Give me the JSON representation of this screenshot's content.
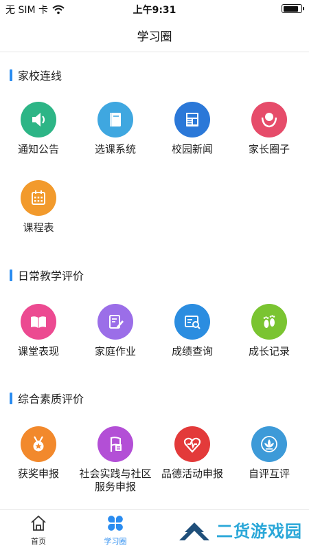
{
  "status_bar": {
    "carrier": "无 SIM 卡",
    "time": "上午9:31",
    "battery_level": 0.9
  },
  "nav": {
    "title": "学习圈"
  },
  "sections": [
    {
      "title": "家校连线",
      "items": [
        {
          "label": "通知公告",
          "icon": "speaker-icon",
          "color": "#2db586"
        },
        {
          "label": "选课系统",
          "icon": "book-icon",
          "color": "#3fa7e0"
        },
        {
          "label": "校园新闻",
          "icon": "newspaper-icon",
          "color": "#2b78d8"
        },
        {
          "label": "家长圈子",
          "icon": "parent-icon",
          "color": "#e64c6a"
        },
        {
          "label": "课程表",
          "icon": "calendar-icon",
          "color": "#f29a2c"
        }
      ]
    },
    {
      "title": "日常教学评价",
      "items": [
        {
          "label": "课堂表现",
          "icon": "open-book-icon",
          "color": "#ec4a91"
        },
        {
          "label": "家庭作业",
          "icon": "homework-icon",
          "color": "#9b6ee8"
        },
        {
          "label": "成绩查询",
          "icon": "grade-search-icon",
          "color": "#2b8de0"
        },
        {
          "label": "成长记录",
          "icon": "footprints-icon",
          "color": "#7ac431"
        }
      ]
    },
    {
      "title": "综合素质评价",
      "items": [
        {
          "label": "获奖申报",
          "icon": "medal-icon",
          "color": "#f2892c"
        },
        {
          "label": "社会实践与社区服务申报",
          "icon": "flag-icon",
          "color": "#b34fd6"
        },
        {
          "label": "品德活动申报",
          "icon": "heart-icon",
          "color": "#e33a3a"
        },
        {
          "label": "自评互评",
          "icon": "lotus-icon",
          "color": "#3d9ad8"
        }
      ]
    }
  ],
  "tab_bar": {
    "tabs": [
      {
        "label": "首页",
        "icon": "home-icon"
      },
      {
        "label": "学习圈",
        "icon": "clover-icon",
        "active": true
      }
    ]
  },
  "watermark": {
    "text": "二货游戏园"
  },
  "colors": {
    "accent": "#2a8cf0"
  }
}
